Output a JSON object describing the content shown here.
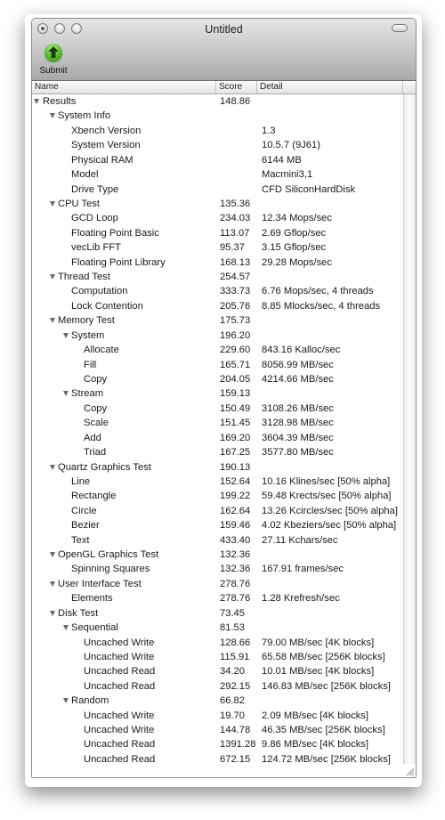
{
  "window": {
    "title": "Untitled",
    "toolbar": {
      "submit_label": "Submit",
      "submit_icon": "upload-arrow-icon"
    }
  },
  "columns": {
    "name": "Name",
    "score": "Score",
    "detail": "Detail"
  },
  "rows": [
    {
      "name": "Results",
      "score": "148.86",
      "detail": "",
      "level": 0,
      "expandable": true
    },
    {
      "name": "System Info",
      "score": "",
      "detail": "",
      "level": 1,
      "expandable": true
    },
    {
      "name": "Xbench Version",
      "score": "",
      "detail": "1.3",
      "level": 2,
      "expandable": false
    },
    {
      "name": "System Version",
      "score": "",
      "detail": "10.5.7 (9J61)",
      "level": 2,
      "expandable": false
    },
    {
      "name": "Physical RAM",
      "score": "",
      "detail": "6144 MB",
      "level": 2,
      "expandable": false
    },
    {
      "name": "Model",
      "score": "",
      "detail": "Macmini3,1",
      "level": 2,
      "expandable": false
    },
    {
      "name": "Drive Type",
      "score": "",
      "detail": "CFD SiliconHardDisk",
      "level": 2,
      "expandable": false
    },
    {
      "name": "CPU Test",
      "score": "135.36",
      "detail": "",
      "level": 1,
      "expandable": true
    },
    {
      "name": "GCD Loop",
      "score": "234.03",
      "detail": "12.34 Mops/sec",
      "level": 2,
      "expandable": false
    },
    {
      "name": "Floating Point Basic",
      "score": "113.07",
      "detail": "2.69 Gflop/sec",
      "level": 2,
      "expandable": false
    },
    {
      "name": "vecLib FFT",
      "score": "95.37",
      "detail": "3.15 Gflop/sec",
      "level": 2,
      "expandable": false
    },
    {
      "name": "Floating Point Library",
      "score": "168.13",
      "detail": "29.28 Mops/sec",
      "level": 2,
      "expandable": false
    },
    {
      "name": "Thread Test",
      "score": "254.57",
      "detail": "",
      "level": 1,
      "expandable": true
    },
    {
      "name": "Computation",
      "score": "333.73",
      "detail": "6.76 Mops/sec, 4 threads",
      "level": 2,
      "expandable": false
    },
    {
      "name": "Lock Contention",
      "score": "205.76",
      "detail": "8.85 Mlocks/sec, 4 threads",
      "level": 2,
      "expandable": false
    },
    {
      "name": "Memory Test",
      "score": "175.73",
      "detail": "",
      "level": 1,
      "expandable": true
    },
    {
      "name": "System",
      "score": "196.20",
      "detail": "",
      "level": 2,
      "expandable": true
    },
    {
      "name": "Allocate",
      "score": "229.60",
      "detail": "843.16 Kalloc/sec",
      "level": 3,
      "expandable": false
    },
    {
      "name": "Fill",
      "score": "165.71",
      "detail": "8056.99 MB/sec",
      "level": 3,
      "expandable": false
    },
    {
      "name": "Copy",
      "score": "204.05",
      "detail": "4214.66 MB/sec",
      "level": 3,
      "expandable": false
    },
    {
      "name": "Stream",
      "score": "159.13",
      "detail": "",
      "level": 2,
      "expandable": true
    },
    {
      "name": "Copy",
      "score": "150.49",
      "detail": "3108.26 MB/sec",
      "level": 3,
      "expandable": false
    },
    {
      "name": "Scale",
      "score": "151.45",
      "detail": "3128.98 MB/sec",
      "level": 3,
      "expandable": false
    },
    {
      "name": "Add",
      "score": "169.20",
      "detail": "3604.39 MB/sec",
      "level": 3,
      "expandable": false
    },
    {
      "name": "Triad",
      "score": "167.25",
      "detail": "3577.80 MB/sec",
      "level": 3,
      "expandable": false
    },
    {
      "name": "Quartz Graphics Test",
      "score": "190.13",
      "detail": "",
      "level": 1,
      "expandable": true
    },
    {
      "name": "Line",
      "score": "152.64",
      "detail": "10.16 Klines/sec [50% alpha]",
      "level": 2,
      "expandable": false
    },
    {
      "name": "Rectangle",
      "score": "199.22",
      "detail": "59.48 Krects/sec [50% alpha]",
      "level": 2,
      "expandable": false
    },
    {
      "name": "Circle",
      "score": "162.64",
      "detail": "13.26 Kcircles/sec [50% alpha]",
      "level": 2,
      "expandable": false
    },
    {
      "name": "Bezier",
      "score": "159.46",
      "detail": "4.02 Kbeziers/sec [50% alpha]",
      "level": 2,
      "expandable": false
    },
    {
      "name": "Text",
      "score": "433.40",
      "detail": "27.11 Kchars/sec",
      "level": 2,
      "expandable": false
    },
    {
      "name": "OpenGL Graphics Test",
      "score": "132.36",
      "detail": "",
      "level": 1,
      "expandable": true
    },
    {
      "name": "Spinning Squares",
      "score": "132.36",
      "detail": "167.91 frames/sec",
      "level": 2,
      "expandable": false
    },
    {
      "name": "User Interface Test",
      "score": "278.76",
      "detail": "",
      "level": 1,
      "expandable": true
    },
    {
      "name": "Elements",
      "score": "278.76",
      "detail": "1.28 Krefresh/sec",
      "level": 2,
      "expandable": false
    },
    {
      "name": "Disk Test",
      "score": "73.45",
      "detail": "",
      "level": 1,
      "expandable": true
    },
    {
      "name": "Sequential",
      "score": "81.53",
      "detail": "",
      "level": 2,
      "expandable": true
    },
    {
      "name": "Uncached Write",
      "score": "128.66",
      "detail": "79.00 MB/sec [4K blocks]",
      "level": 3,
      "expandable": false
    },
    {
      "name": "Uncached Write",
      "score": "115.91",
      "detail": "65.58 MB/sec [256K blocks]",
      "level": 3,
      "expandable": false
    },
    {
      "name": "Uncached Read",
      "score": "34.20",
      "detail": "10.01 MB/sec [4K blocks]",
      "level": 3,
      "expandable": false
    },
    {
      "name": "Uncached Read",
      "score": "292.15",
      "detail": "146.83 MB/sec [256K blocks]",
      "level": 3,
      "expandable": false
    },
    {
      "name": "Random",
      "score": "66.82",
      "detail": "",
      "level": 2,
      "expandable": true
    },
    {
      "name": "Uncached Write",
      "score": "19.70",
      "detail": "2.09 MB/sec [4K blocks]",
      "level": 3,
      "expandable": false
    },
    {
      "name": "Uncached Write",
      "score": "144.78",
      "detail": "46.35 MB/sec [256K blocks]",
      "level": 3,
      "expandable": false
    },
    {
      "name": "Uncached Read",
      "score": "1391.28",
      "detail": "9.86 MB/sec [4K blocks]",
      "level": 3,
      "expandable": false
    },
    {
      "name": "Uncached Read",
      "score": "672.15",
      "detail": "124.72 MB/sec [256K blocks]",
      "level": 3,
      "expandable": false
    }
  ]
}
